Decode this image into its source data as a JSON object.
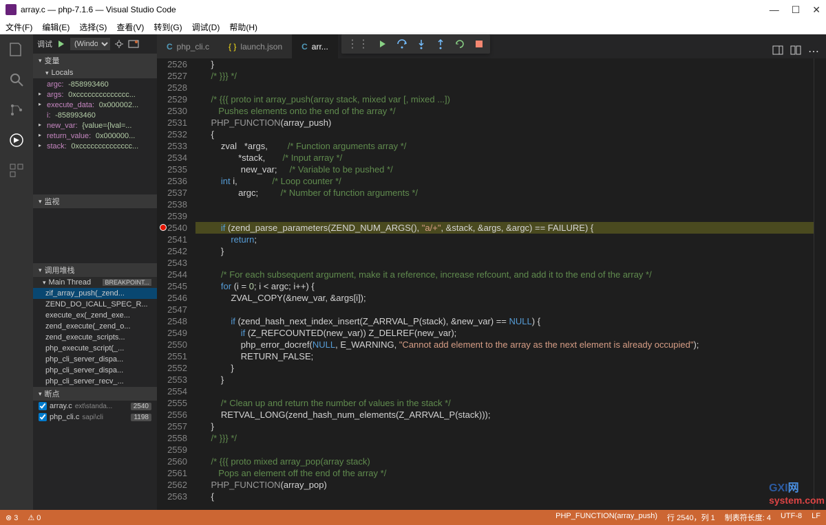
{
  "title": "array.c — php-7.1.6 — Visual Studio Code",
  "menus": [
    "文件(F)",
    "编辑(E)",
    "选择(S)",
    "查看(V)",
    "转到(G)",
    "调试(D)",
    "帮助(H)"
  ],
  "debugDropdown": "调试",
  "debugConfig": "(Windows)",
  "sections": {
    "vars": "变量",
    "locals": "Locals",
    "watch": "监视",
    "callstack": "调用堆栈",
    "breakpoints": "断点"
  },
  "locals": [
    {
      "name": "argc:",
      "value": "-858993460",
      "exp": false
    },
    {
      "name": "args:",
      "value": "0xcccccccccccccc...",
      "exp": true
    },
    {
      "name": "execute_data:",
      "value": "0x000002...",
      "exp": true
    },
    {
      "name": "i:",
      "value": "-858993460",
      "exp": false
    },
    {
      "name": "new_var:",
      "value": "{value={lval=...",
      "exp": true
    },
    {
      "name": "return_value:",
      "value": "0x000000...",
      "exp": true
    },
    {
      "name": "stack:",
      "value": "0xcccccccccccccc...",
      "exp": true
    }
  ],
  "mainThread": "Main Thread",
  "breakpointTag": "BREAKPOINT...",
  "callstack": [
    "zif_array_push(_zend...",
    "ZEND_DO_ICALL_SPEC_R...",
    "execute_ex(_zend_exe...",
    "zend_execute(_zend_o...",
    "zend_execute_scripts...",
    "php_execute_script(_...",
    "php_cli_server_dispa...",
    "php_cli_server_dispa...",
    "php_cli_server_recv_..."
  ],
  "breakpoints": [
    {
      "file": "array.c",
      "path": "ext\\standa...",
      "line": "2540"
    },
    {
      "file": "php_cli.c",
      "path": "sapi\\cli",
      "line": "1198"
    }
  ],
  "tabs": [
    {
      "label": "php_cli.c",
      "lang": "C",
      "active": false
    },
    {
      "label": "launch.json",
      "lang": "{}",
      "active": false
    },
    {
      "label": "arr...",
      "lang": "C",
      "active": true
    }
  ],
  "startLine": 2526,
  "highlightLine": 2540,
  "code": [
    [
      [
        "    }",
        ""
      ]
    ],
    [
      [
        "    ",
        ""
      ],
      [
        "/* }}} */",
        "c"
      ]
    ],
    [
      [
        "",
        ""
      ]
    ],
    [
      [
        "    ",
        ""
      ],
      [
        "/* {{{ proto int array_push(array stack, mixed var [, mixed ...])",
        "c"
      ]
    ],
    [
      [
        "       Pushes elements onto the end of the array */",
        "c"
      ]
    ],
    [
      [
        "    ",
        ""
      ],
      [
        "PHP_FUNCTION",
        "m"
      ],
      [
        "(array_push)",
        ""
      ]
    ],
    [
      [
        "    {",
        ""
      ]
    ],
    [
      [
        "        zval   *args,        ",
        ""
      ],
      [
        "/* Function arguments array */",
        "c"
      ]
    ],
    [
      [
        "               *stack,       ",
        ""
      ],
      [
        "/* Input array */",
        "c"
      ]
    ],
    [
      [
        "                new_var;     ",
        ""
      ],
      [
        "/* Variable to be pushed */",
        "c"
      ]
    ],
    [
      [
        "        ",
        ""
      ],
      [
        "int",
        "k"
      ],
      [
        " i,              ",
        ""
      ],
      [
        "/* Loop counter */",
        "c"
      ]
    ],
    [
      [
        "               argc;         ",
        ""
      ],
      [
        "/* Number of function arguments */",
        "c"
      ]
    ],
    [
      [
        "",
        ""
      ]
    ],
    [
      [
        "",
        ""
      ]
    ],
    [
      [
        "        ",
        ""
      ],
      [
        "if",
        "k"
      ],
      [
        " (zend_parse_parameters(ZEND_NUM_ARGS(), ",
        ""
      ],
      [
        "\"a/+\"",
        "s"
      ],
      [
        ", &stack, &args, &argc) == FAILURE) {",
        ""
      ]
    ],
    [
      [
        "            ",
        ""
      ],
      [
        "return",
        "k"
      ],
      [
        ";",
        ""
      ]
    ],
    [
      [
        "        }",
        ""
      ]
    ],
    [
      [
        "",
        ""
      ]
    ],
    [
      [
        "        ",
        ""
      ],
      [
        "/* For each subsequent argument, make it a reference, increase refcount, and add it to the end of the array */",
        "c"
      ]
    ],
    [
      [
        "        ",
        ""
      ],
      [
        "for",
        "k"
      ],
      [
        " (i = ",
        ""
      ],
      [
        "0",
        "n"
      ],
      [
        "; i < argc; i++) {",
        ""
      ]
    ],
    [
      [
        "            ZVAL_COPY(&new_var, &args[i]);",
        ""
      ]
    ],
    [
      [
        "",
        ""
      ]
    ],
    [
      [
        "            ",
        ""
      ],
      [
        "if",
        "k"
      ],
      [
        " (zend_hash_next_index_insert(Z_ARRVAL_P(stack), &new_var) == ",
        ""
      ],
      [
        "NULL",
        "k"
      ],
      [
        ") {",
        ""
      ]
    ],
    [
      [
        "                ",
        ""
      ],
      [
        "if",
        "k"
      ],
      [
        " (Z_REFCOUNTED(new_var)) Z_DELREF(new_var);",
        ""
      ]
    ],
    [
      [
        "                php_error_docref(",
        ""
      ],
      [
        "NULL",
        "k"
      ],
      [
        ", E_WARNING, ",
        ""
      ],
      [
        "\"Cannot add element to the array as the next element is already occupied\"",
        "s"
      ],
      [
        ");",
        ""
      ]
    ],
    [
      [
        "                RETURN_FALSE;",
        ""
      ]
    ],
    [
      [
        "            }",
        ""
      ]
    ],
    [
      [
        "        }",
        ""
      ]
    ],
    [
      [
        "",
        ""
      ]
    ],
    [
      [
        "        ",
        ""
      ],
      [
        "/* Clean up and return the number of values in the stack */",
        "c"
      ]
    ],
    [
      [
        "        RETVAL_LONG(zend_hash_num_elements(Z_ARRVAL_P(stack)));",
        ""
      ]
    ],
    [
      [
        "    }",
        ""
      ]
    ],
    [
      [
        "    ",
        ""
      ],
      [
        "/* }}} */",
        "c"
      ]
    ],
    [
      [
        "",
        ""
      ]
    ],
    [
      [
        "    ",
        ""
      ],
      [
        "/* {{{ proto mixed array_pop(array stack)",
        "c"
      ]
    ],
    [
      [
        "       Pops an element off the end of the array */",
        "c"
      ]
    ],
    [
      [
        "    ",
        ""
      ],
      [
        "PHP_FUNCTION",
        "m"
      ],
      [
        "(array_pop)",
        ""
      ]
    ],
    [
      [
        "    {",
        ""
      ]
    ]
  ],
  "statusbar": {
    "errors": "⊗ 3",
    "warnings": "⚠ 0",
    "func": "PHP_FUNCTION(array_push)",
    "pos": "行 2540，列 1",
    "tab": "制表符长度: 4",
    "enc": "UTF-8",
    "eol": "LF"
  },
  "watermark": {
    "main": "GXI",
    "sub": "网",
    "small": "system.com"
  }
}
